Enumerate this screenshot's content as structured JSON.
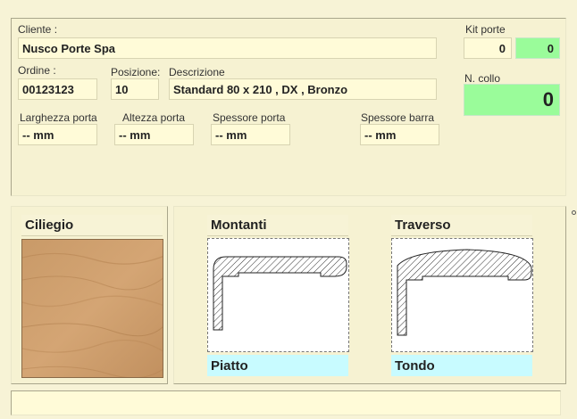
{
  "cliente": {
    "label": "Cliente :",
    "value": "Nusco Porte Spa"
  },
  "ordine": {
    "label": "Ordine :",
    "value": "00123123"
  },
  "posizione": {
    "label": "Posizione:",
    "value": "10"
  },
  "descrizione": {
    "label": "Descrizione",
    "value": "Standard  80 x 210 , DX , Bronzo"
  },
  "kit_porte": {
    "label": "Kit  porte",
    "value_1": "0",
    "value_2": "0"
  },
  "n_collo": {
    "label": "N. collo",
    "value": "0"
  },
  "larghezza": {
    "label": "Larghezza porta",
    "value": "-- mm"
  },
  "altezza": {
    "label": "Altezza porta",
    "value": "-- mm"
  },
  "spessore_porta": {
    "label": "Spessore porta",
    "value": "-- mm"
  },
  "spessore_barra": {
    "label": "Spessore barra",
    "value": "-- mm"
  },
  "finish": {
    "name": "Ciliegio"
  },
  "montanti": {
    "title": "Montanti",
    "type": "Piatto"
  },
  "traverso": {
    "title": "Traverso",
    "type": "Tondo"
  },
  "colors": {
    "green": "#9afc9a",
    "cyan": "#c8fbff",
    "field": "#fffbd8",
    "wood": "#c99a68"
  }
}
